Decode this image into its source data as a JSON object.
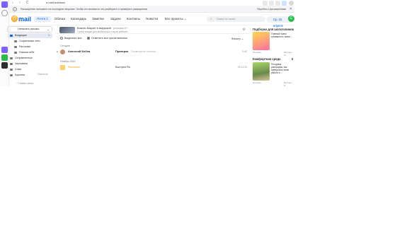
{
  "browser": {
    "url": "e.mail.ru/inbox/",
    "back": "‹",
    "forward": "›",
    "reload": "C",
    "window_controls": "— ◻ ✕",
    "infobar_text": "Расширение наложено на последних версиях. Чтобы его включить что разберите и проверьте расширения",
    "infobar_link": "Перейти к расширениям",
    "infobar_close": "✕"
  },
  "strip_icons": [
    {
      "name": "tab-icon-1",
      "color": "#7b61ff"
    },
    {
      "name": "tab-icon-2",
      "color": "#999999"
    },
    {
      "name": "app-icon-1",
      "color": "#7b61ff"
    },
    {
      "name": "app-icon-2",
      "color": "#2bbb4a"
    },
    {
      "name": "app-icon-3",
      "color": "#2c2d2e"
    }
  ],
  "header": {
    "logo": "mail",
    "nav": [
      {
        "label": "Почта 1",
        "active": true
      },
      {
        "label": "Облако"
      },
      {
        "label": "Календарь"
      },
      {
        "label": "Заметки"
      },
      {
        "label": "Задачи"
      },
      {
        "label": "Контакты"
      },
      {
        "label": "Новости"
      },
      {
        "label": "Все проекты ⌄"
      }
    ],
    "search_placeholder": "Поиск по почте",
    "weather": "Ср, 15 апреля",
    "avatar": "G"
  },
  "sidebar": {
    "compose": "Написать письмо",
    "folders": [
      {
        "label": "Входящие",
        "count": "1",
        "active": true
      },
      {
        "label": "Социальные сети",
        "sub": true
      },
      {
        "label": "Рассылки",
        "sub": true
      },
      {
        "label": "Письма себе",
        "sub": true
      },
      {
        "label": "Отправленные"
      },
      {
        "label": "Черновики"
      },
      {
        "label": "Спам"
      },
      {
        "label": "Корзина"
      }
    ],
    "clear": "Очистить",
    "new_folder": "+ Новая папка"
  },
  "main": {
    "promo_title": "Бизнес-Маркет в Амурской",
    "promo_ad": "· реклама 0+",
    "promo_text": "Супер скидки для мобильных старта рабочих",
    "select_all": "Выделить все",
    "mark_read": "Отметить все прочитанными",
    "filter": "Фильтр ⌄",
    "sections": [
      "Сегодня",
      "Ноябрь 2023"
    ],
    "rows": [
      {
        "sender": "Анатолий Бобов",
        "subject": "Проверка",
        "snippet": "Посмотрите письмо...",
        "date": "0:40"
      },
      {
        "sender": "Рассылки",
        "subject": "Быстрее Ru",
        "snippet": "",
        "date": "09.11.23"
      }
    ]
  },
  "right": {
    "section1": "Подборка для шопоголиков",
    "card1_text": "Главный ткани гремяшного ткани ...",
    "card1_tag": "Реклама",
    "card1_side": "Быстрее 0+",
    "section2": "Комфортная среда",
    "section2_mark": "5",
    "card2_text": "Погодные распродаж, как превратить свою работа в ...",
    "card2_tag": "Реклама",
    "card2_side": "Быстрее 0+"
  }
}
